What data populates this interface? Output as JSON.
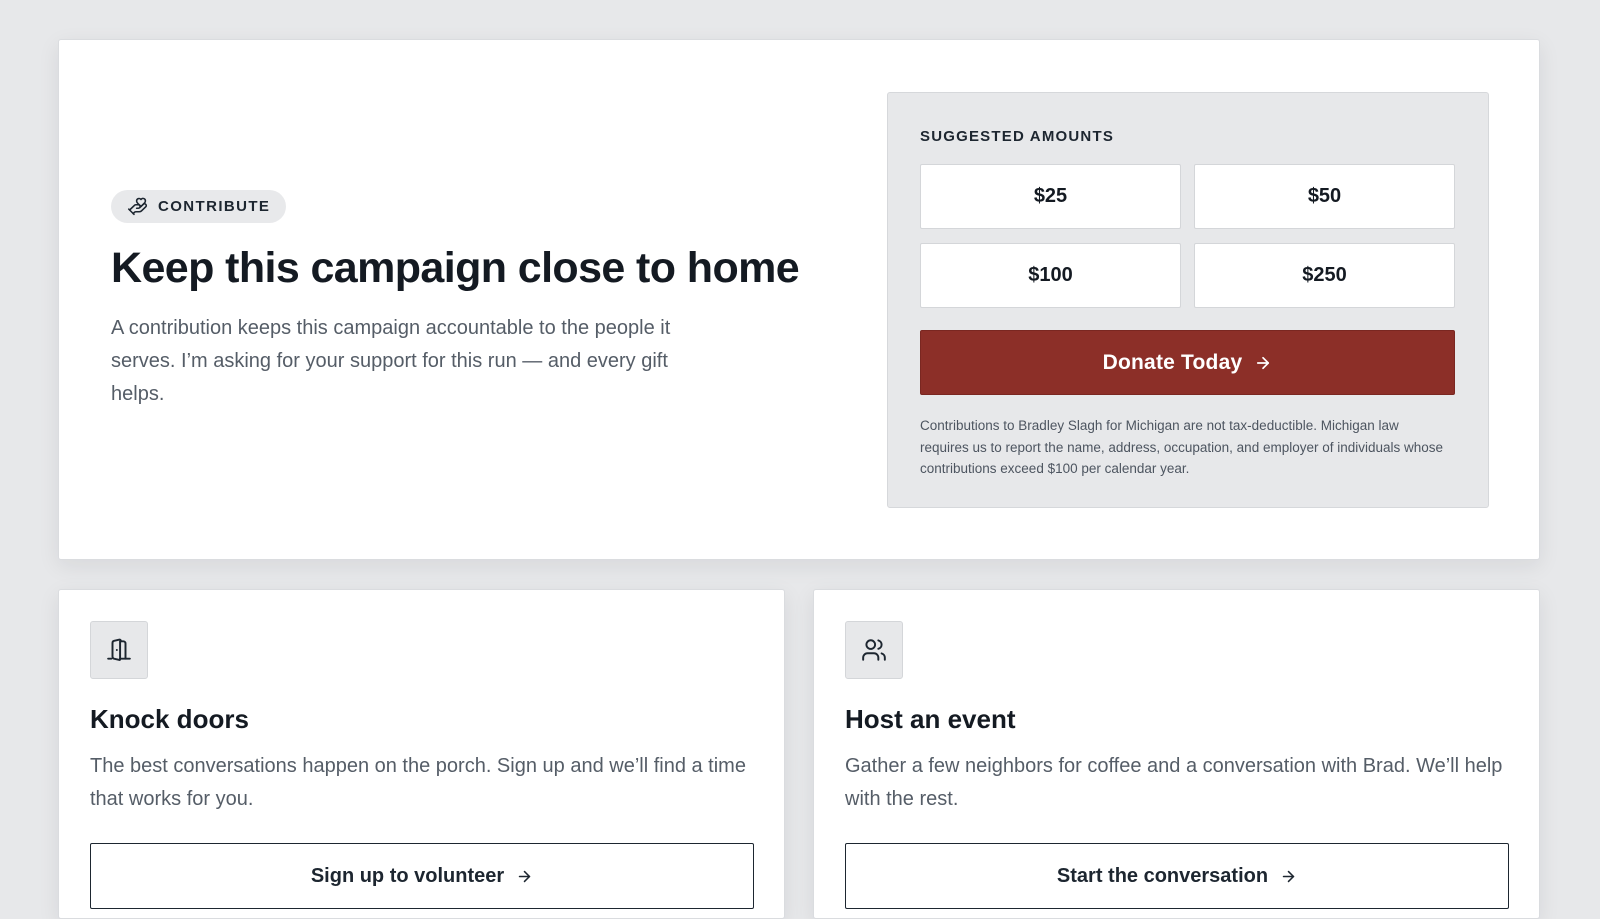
{
  "contribute": {
    "badge_icon": "hand-heart-icon",
    "badge_label": "CONTRIBUTE",
    "title": "Keep this campaign close to home",
    "description": "A contribution keeps this campaign accountable to the people it serves. I’m asking for your support for this run — and every gift helps."
  },
  "donate_panel": {
    "heading": "SUGGESTED AMOUNTS",
    "amounts": [
      "$25",
      "$50",
      "$100",
      "$250"
    ],
    "donate_label": "Donate Today",
    "donate_icon": "arrow-right-icon",
    "disclaimer": "Contributions to Bradley Slagh for Michigan are not tax-deductible. Michigan law requires us to report the name, address, occupation, and employer of individuals whose contributions exceed $100 per calendar year.",
    "accent_color": "#8c2f28"
  },
  "cards": [
    {
      "icon": "door-icon",
      "title": "Knock doors",
      "description": "The best conversations happen on the porch. Sign up and we’ll find a time that works for you.",
      "button_label": "Sign up to volunteer",
      "button_icon": "arrow-right-icon"
    },
    {
      "icon": "users-icon",
      "title": "Host an event",
      "description": "Gather a few neighbors for coffee and a conversation with Brad. We’ll help with the rest.",
      "button_label": "Start the conversation",
      "button_icon": "arrow-right-icon"
    }
  ]
}
